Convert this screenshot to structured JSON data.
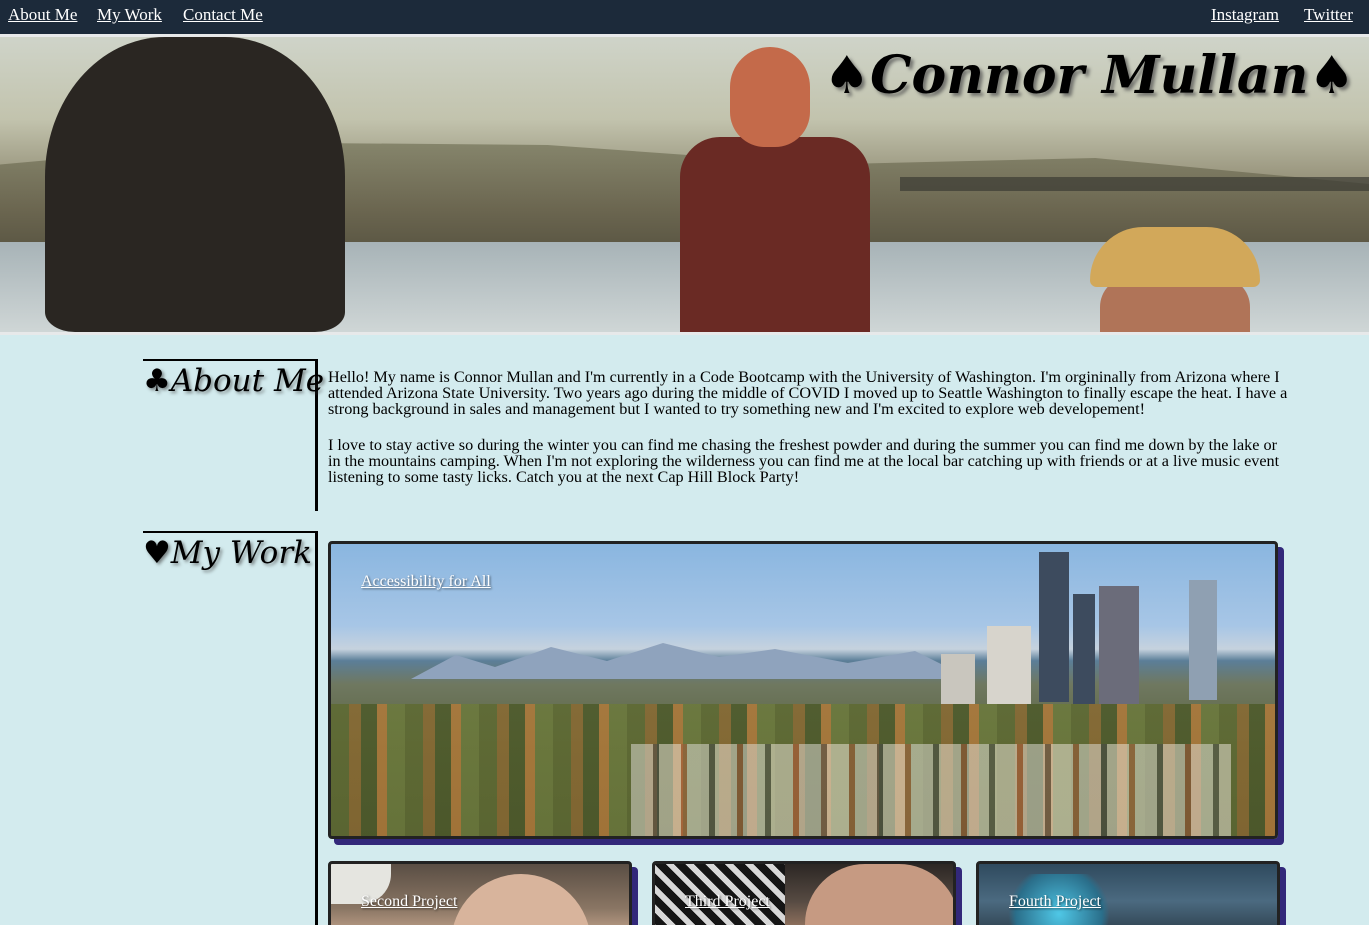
{
  "nav": {
    "left": [
      "About Me",
      "My Work",
      "Contact Me"
    ],
    "right": [
      "Instagram",
      "Twitter"
    ]
  },
  "hero": {
    "title": "♠Connor Mullan♠"
  },
  "about": {
    "heading": "♣About Me",
    "paragraphs": [
      "Hello! My name is Connor Mullan and I'm currently in a Code Bootcamp with the University of Washington. I'm orgininally from Arizona where I attended Arizona State University. Two years ago during the middle of COVID I moved up to Seattle Washington to finally escape the heat. I have a strong background in sales and management but I wanted to try something new and I'm excited to explore web developement!",
      "I love to stay active so during the winter you can find me chasing the freshest powder and during the summer you can find me down by the lake or in the mountains camping. When I'm not exploring the wilderness you can find me at the local bar catching up with friends or at a live music event listening to some tasty licks. Catch you at the next Cap Hill Block Party!"
    ]
  },
  "work": {
    "heading": "♥My Work",
    "projects": [
      "Accessibility for All",
      "Second Project",
      "Third Project",
      "Fourth Project"
    ]
  },
  "colors": {
    "nav_bg": "#1c2a3a",
    "page_bg": "#d3ebee",
    "card_shadow": "#32287a"
  }
}
